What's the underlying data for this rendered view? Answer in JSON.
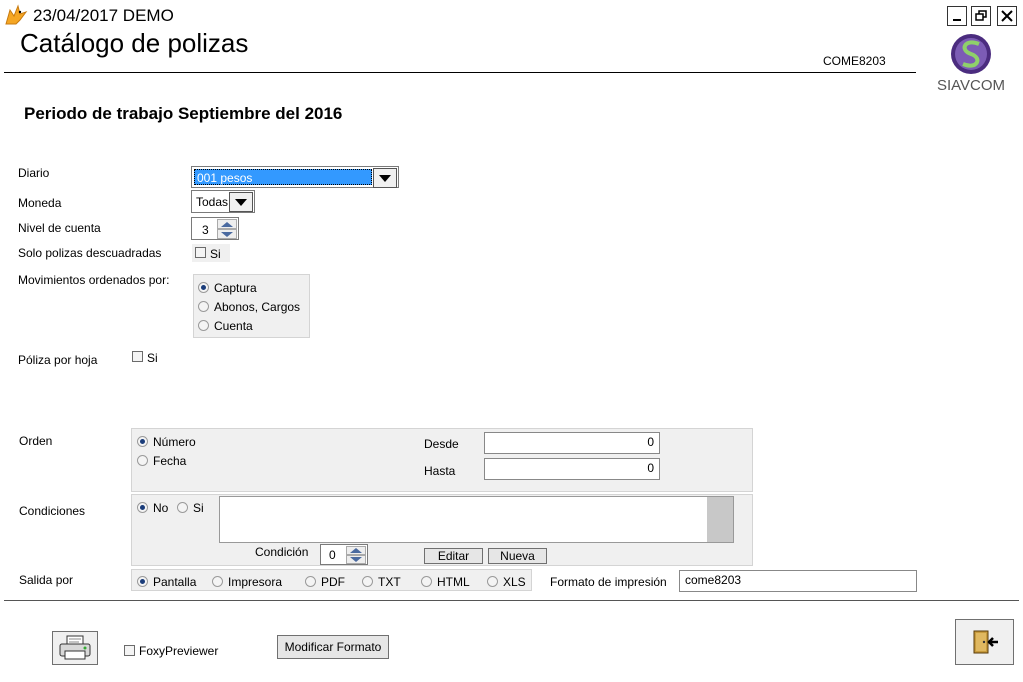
{
  "window": {
    "title": "23/04/2017  DEMO",
    "controls": [
      "minimize-icon",
      "restore-icon",
      "close-icon"
    ]
  },
  "form": {
    "title": "Catálogo de polizas",
    "code": "COME8203",
    "logo_text": "SIAVCOM",
    "periodo": "Periodo de trabajo Septiembre del 2016"
  },
  "fields": {
    "diario": {
      "label": "Diario",
      "value": "001 pesos"
    },
    "moneda": {
      "label": "Moneda",
      "value": "Todas"
    },
    "nivel": {
      "label": "Nivel de cuenta",
      "value": "3"
    },
    "solo_descuadradas": {
      "label": "Solo polizas descuadradas",
      "option": "Si",
      "checked": false
    },
    "movimientos": {
      "label": "Movimientos ordenados por:",
      "options": [
        "Captura",
        "Abonos, Cargos",
        "Cuenta"
      ],
      "selected": 0
    },
    "poliza_hoja": {
      "label": "Póliza por hoja",
      "option": "Si",
      "checked": false
    },
    "orden": {
      "label": "Orden",
      "options": [
        "Número",
        "Fecha"
      ],
      "selected": 0,
      "desde_label": "Desde",
      "desde_value": "0",
      "hasta_label": "Hasta",
      "hasta_value": "0"
    },
    "condiciones": {
      "label": "Condiciones",
      "options": [
        "No",
        "Si"
      ],
      "selected": 0,
      "condicion_label": "Condición",
      "condicion_value": "0",
      "editar": "Editar",
      "nueva": "Nueva"
    },
    "salida": {
      "label": "Salida por",
      "options": [
        "Pantalla",
        "Impresora",
        "PDF",
        "TXT",
        "HTML",
        "XLS"
      ],
      "selected": 0,
      "formato_label": "Formato de impresión",
      "formato_value": "come8203"
    }
  },
  "footer": {
    "foxy_label": "FoxyPreviewer",
    "foxy_checked": false,
    "modificar": "Modificar Formato",
    "print_icon": "printer-icon",
    "exit_icon": "exit-door-icon"
  },
  "colors": {
    "selection": "#3399ff",
    "logo": "#5b3a8f"
  }
}
